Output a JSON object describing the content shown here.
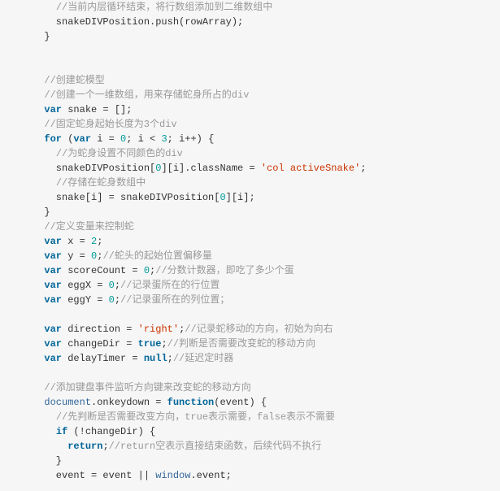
{
  "lines": [
    {
      "indent": 2,
      "tokens": [
        {
          "cls": "cm",
          "text": "//当前内层循环结束，将行数组添加到二维数组中"
        }
      ]
    },
    {
      "indent": 2,
      "tokens": [
        {
          "text": "snakeDIVPosition.push(rowArray);"
        }
      ]
    },
    {
      "indent": 1,
      "tokens": [
        {
          "text": "}"
        }
      ]
    },
    {
      "indent": 0,
      "tokens": [
        {
          "text": ""
        }
      ]
    },
    {
      "indent": 0,
      "tokens": [
        {
          "text": ""
        }
      ]
    },
    {
      "indent": 1,
      "tokens": [
        {
          "cls": "cm",
          "text": "//创建蛇模型"
        }
      ]
    },
    {
      "indent": 1,
      "tokens": [
        {
          "cls": "cm",
          "text": "//创建一个一维数组，用来存储蛇身所占的div"
        }
      ]
    },
    {
      "indent": 1,
      "tokens": [
        {
          "cls": "kw",
          "text": "var"
        },
        {
          "text": " snake = [];"
        }
      ]
    },
    {
      "indent": 1,
      "tokens": [
        {
          "cls": "cm",
          "text": "//固定蛇身起始长度为3个div"
        }
      ]
    },
    {
      "indent": 1,
      "tokens": [
        {
          "cls": "kw",
          "text": "for"
        },
        {
          "text": " ("
        },
        {
          "cls": "kw",
          "text": "var"
        },
        {
          "text": " i = "
        },
        {
          "cls": "nm",
          "text": "0"
        },
        {
          "text": "; i < "
        },
        {
          "cls": "nm",
          "text": "3"
        },
        {
          "text": "; i++) {"
        }
      ]
    },
    {
      "indent": 2,
      "tokens": [
        {
          "cls": "cm",
          "text": "//为蛇身设置不同颜色的div"
        }
      ]
    },
    {
      "indent": 2,
      "tokens": [
        {
          "text": "snakeDIVPosition["
        },
        {
          "cls": "nm",
          "text": "0"
        },
        {
          "text": "][i].className = "
        },
        {
          "cls": "st",
          "text": "'col activeSnake'"
        },
        {
          "text": ";"
        }
      ]
    },
    {
      "indent": 2,
      "tokens": [
        {
          "cls": "cm",
          "text": "//存储在蛇身数组中"
        }
      ]
    },
    {
      "indent": 2,
      "tokens": [
        {
          "text": "snake[i] = snakeDIVPosition["
        },
        {
          "cls": "nm",
          "text": "0"
        },
        {
          "text": "][i];"
        }
      ]
    },
    {
      "indent": 1,
      "tokens": [
        {
          "text": "}"
        }
      ]
    },
    {
      "indent": 1,
      "tokens": [
        {
          "cls": "cm",
          "text": "//定义变量来控制蛇"
        }
      ]
    },
    {
      "indent": 1,
      "tokens": [
        {
          "cls": "kw",
          "text": "var"
        },
        {
          "text": " x = "
        },
        {
          "cls": "nm",
          "text": "2"
        },
        {
          "text": ";"
        }
      ]
    },
    {
      "indent": 1,
      "tokens": [
        {
          "cls": "kw",
          "text": "var"
        },
        {
          "text": " y = "
        },
        {
          "cls": "nm",
          "text": "0"
        },
        {
          "text": ";"
        },
        {
          "cls": "cm",
          "text": "//蛇头的起始位置偏移量"
        }
      ]
    },
    {
      "indent": 1,
      "tokens": [
        {
          "cls": "kw",
          "text": "var"
        },
        {
          "text": " scoreCount = "
        },
        {
          "cls": "nm",
          "text": "0"
        },
        {
          "text": ";"
        },
        {
          "cls": "cm",
          "text": "//分数计数器，即吃了多少个蛋"
        }
      ]
    },
    {
      "indent": 1,
      "tokens": [
        {
          "cls": "kw",
          "text": "var"
        },
        {
          "text": " eggX = "
        },
        {
          "cls": "nm",
          "text": "0"
        },
        {
          "text": ";"
        },
        {
          "cls": "cm",
          "text": "//记录蛋所在的行位置"
        }
      ]
    },
    {
      "indent": 1,
      "tokens": [
        {
          "cls": "kw",
          "text": "var"
        },
        {
          "text": " eggY = "
        },
        {
          "cls": "nm",
          "text": "0"
        },
        {
          "text": ";"
        },
        {
          "cls": "cm",
          "text": "//记录蛋所在的列位置；"
        }
      ]
    },
    {
      "indent": 0,
      "tokens": [
        {
          "text": ""
        }
      ]
    },
    {
      "indent": 1,
      "tokens": [
        {
          "cls": "kw",
          "text": "var"
        },
        {
          "text": " direction = "
        },
        {
          "cls": "st",
          "text": "'right'"
        },
        {
          "text": ";"
        },
        {
          "cls": "cm",
          "text": "//记录蛇移动的方向，初始为向右"
        }
      ]
    },
    {
      "indent": 1,
      "tokens": [
        {
          "cls": "kw",
          "text": "var"
        },
        {
          "text": " changeDir = "
        },
        {
          "cls": "kw",
          "text": "true"
        },
        {
          "text": ";"
        },
        {
          "cls": "cm",
          "text": "//判断是否需要改变蛇的移动方向"
        }
      ]
    },
    {
      "indent": 1,
      "tokens": [
        {
          "cls": "kw",
          "text": "var"
        },
        {
          "text": " delayTimer = "
        },
        {
          "cls": "kw",
          "text": "null"
        },
        {
          "text": ";"
        },
        {
          "cls": "cm",
          "text": "//延迟定时器"
        }
      ]
    },
    {
      "indent": 0,
      "tokens": [
        {
          "text": ""
        }
      ]
    },
    {
      "indent": 1,
      "tokens": [
        {
          "cls": "cm",
          "text": "//添加键盘事件监听方向键来改变蛇的移动方向"
        }
      ]
    },
    {
      "indent": 1,
      "tokens": [
        {
          "cls": "fn",
          "text": "document"
        },
        {
          "text": ".onkeydown = "
        },
        {
          "cls": "kw",
          "text": "function"
        },
        {
          "text": "(event) {"
        }
      ]
    },
    {
      "indent": 2,
      "tokens": [
        {
          "cls": "cm",
          "text": "//先判断是否需要改变方向，true表示需要，false表示不需要"
        }
      ]
    },
    {
      "indent": 2,
      "tokens": [
        {
          "cls": "kw",
          "text": "if"
        },
        {
          "text": " (!changeDir) {"
        }
      ]
    },
    {
      "indent": 3,
      "tokens": [
        {
          "cls": "kw",
          "text": "return"
        },
        {
          "text": ";"
        },
        {
          "cls": "cm",
          "text": "//return空表示直接结束函数，后续代码不执行"
        }
      ]
    },
    {
      "indent": 2,
      "tokens": [
        {
          "text": "}"
        }
      ]
    },
    {
      "indent": 2,
      "tokens": [
        {
          "text": "event = event || "
        },
        {
          "cls": "fn",
          "text": "window"
        },
        {
          "text": ".event;"
        }
      ]
    }
  ]
}
